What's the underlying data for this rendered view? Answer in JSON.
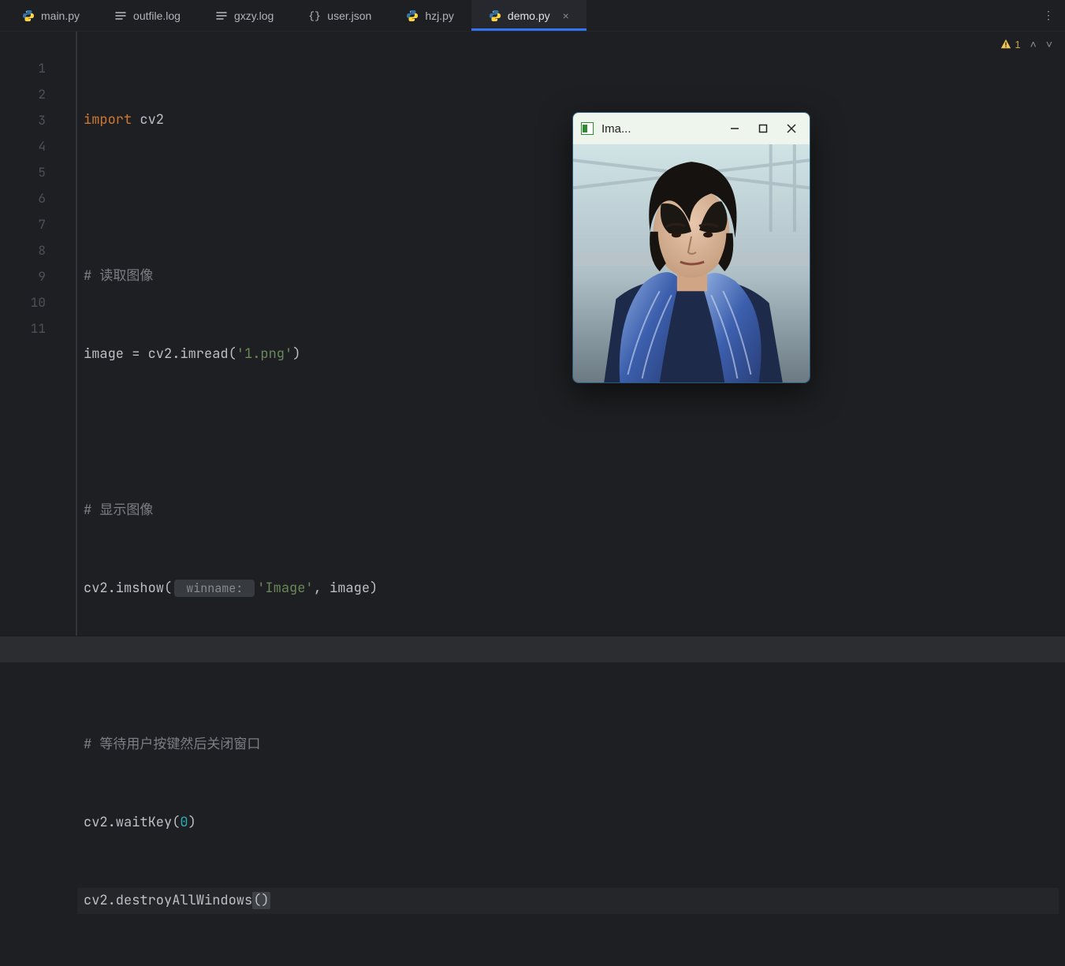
{
  "tabs": [
    {
      "label": "main.py",
      "icon": "python"
    },
    {
      "label": "outfile.log",
      "icon": "lines"
    },
    {
      "label": "gxzy.log",
      "icon": "lines"
    },
    {
      "label": "user.json",
      "icon": "braces"
    },
    {
      "label": "hzj.py",
      "icon": "python"
    },
    {
      "label": "demo.py",
      "icon": "python",
      "active": true,
      "close": "×"
    }
  ],
  "status": {
    "warning_count": "1",
    "up": "˄",
    "down": "˅"
  },
  "menu_glyph": "⋮",
  "gutter": [
    "1",
    "2",
    "3",
    "4",
    "5",
    "6",
    "7",
    "8",
    "9",
    "10",
    "11"
  ],
  "code": {
    "l1_kw": "import",
    "l1_mod": " cv2",
    "l3_cmt": "# 读取图像",
    "l4_a": "image = cv2.imread(",
    "l4_str": "'1.png'",
    "l4_b": ")",
    "l6_cmt": "# 显示图像",
    "l7_a": "cv2.imshow(",
    "l7_inlay": " winname: ",
    "l7_str": "'Image'",
    "l7_b": ", image)",
    "l9_cmt": "# 等待用户按键然后关闭窗口",
    "l10_a": "cv2.waitKey(",
    "l10_num": "0",
    "l10_b": ")",
    "l11_a": "cv2.destroyAllWindows",
    "l11_paren": "()"
  },
  "image_window": {
    "title": "Ima...",
    "minimize": "—",
    "maximize": "□",
    "close": "✕"
  }
}
